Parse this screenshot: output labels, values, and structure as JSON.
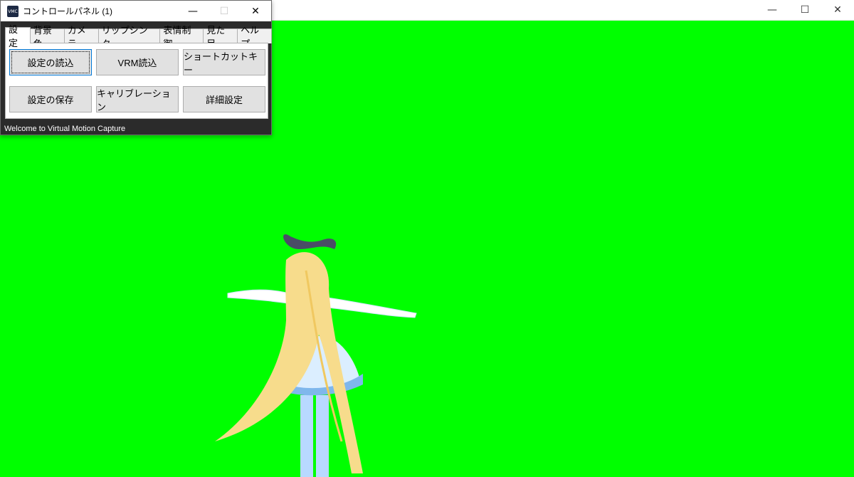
{
  "main_window": {
    "controls": {
      "minimize": "—",
      "maximize": "☐",
      "close": "✕"
    }
  },
  "control_panel": {
    "icon_text": "VMC",
    "title": "コントロールパネル (1)",
    "controls": {
      "minimize": "—",
      "maximize": "☐",
      "close": "✕"
    },
    "tabs": [
      {
        "label": "設定"
      },
      {
        "label": "背景色"
      },
      {
        "label": "カメラ"
      },
      {
        "label": "リップシンク"
      },
      {
        "label": "表情制御"
      },
      {
        "label": "見た目"
      },
      {
        "label": "ヘルプ"
      }
    ],
    "buttons": {
      "load_settings": "設定の読込",
      "load_vrm": "VRM読込",
      "shortcut_keys": "ショートカットキー",
      "save_settings": "設定の保存",
      "calibration": "キャリブレーション",
      "advanced_settings": "詳細設定"
    },
    "status_text": "Welcome to Virtual Motion Capture"
  },
  "colors": {
    "background": "#00ff00",
    "status_bar": "#2b2b2b"
  }
}
